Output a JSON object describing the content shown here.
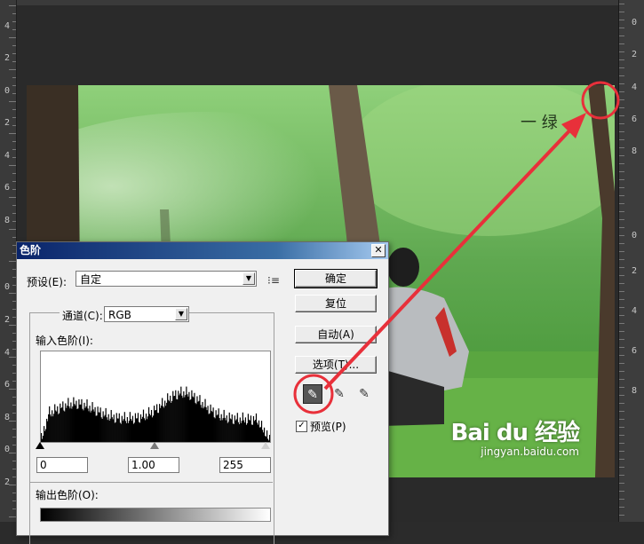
{
  "rulers": {
    "left_labels": [
      "4",
      "2",
      "0",
      "2",
      "4",
      "6",
      "8",
      "0",
      "2",
      "4",
      "6",
      "8",
      "0",
      "2"
    ],
    "right_labels": [
      "0",
      "2",
      "4",
      "6",
      "8",
      "0",
      "2",
      "4",
      "6",
      "8"
    ]
  },
  "photo": {
    "watermark_brand": "Bai du 经验",
    "watermark_url": "jingyan.baidu.com",
    "top_text": "一 绿"
  },
  "dialog": {
    "title": "色阶",
    "close_label": "✕",
    "preset_label": "预设(E):",
    "preset_value": "自定",
    "channel_label": "通道(C):",
    "channel_value": "RGB",
    "input_levels_label": "输入色阶(I):",
    "input_black": "0",
    "input_gamma": "1.00",
    "input_white": "255",
    "output_levels_label": "输出色阶(O):",
    "buttons": {
      "ok": "确定",
      "reset": "复位",
      "auto": "自动(A)",
      "options": "选项(T)..."
    },
    "preview_label": "预览(P)",
    "preview_checked": true
  },
  "colors": {
    "annotation": "#e8303a",
    "dialog_bg": "#f0f0f0"
  }
}
